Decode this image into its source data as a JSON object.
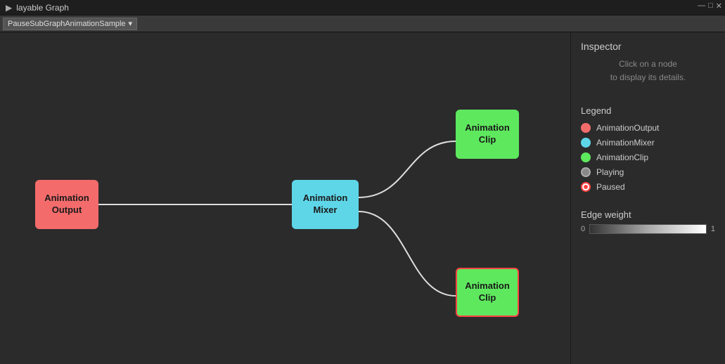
{
  "titlebar": {
    "title": "layable Graph",
    "minimize": "—",
    "maximize": "□",
    "close": "✕"
  },
  "toolbar": {
    "dropdown_label": "PauseSubGraphAnimationSample",
    "dropdown_arrow": "▾"
  },
  "graph": {
    "nodes": [
      {
        "id": "animation-output",
        "label": "Animation\nOutput",
        "type": "output"
      },
      {
        "id": "animation-mixer",
        "label": "Animation\nMixer",
        "type": "mixer"
      },
      {
        "id": "animation-clip-top",
        "label": "Animation\nClip",
        "type": "clip-top"
      },
      {
        "id": "animation-clip-bottom",
        "label": "Animation\nClip",
        "type": "clip-bottom"
      }
    ]
  },
  "inspector": {
    "title": "Inspector",
    "hint_line1": "Click on a node",
    "hint_line2": "to display its details."
  },
  "legend": {
    "title": "Legend",
    "items": [
      {
        "type": "output",
        "label": "AnimationOutput"
      },
      {
        "type": "mixer",
        "label": "AnimationMixer"
      },
      {
        "type": "clip",
        "label": "AnimationClip"
      },
      {
        "type": "playing",
        "label": "Playing"
      },
      {
        "type": "paused",
        "label": "Paused"
      }
    ]
  },
  "edge_weight": {
    "title": "Edge weight",
    "min_label": "0",
    "max_label": "1"
  }
}
